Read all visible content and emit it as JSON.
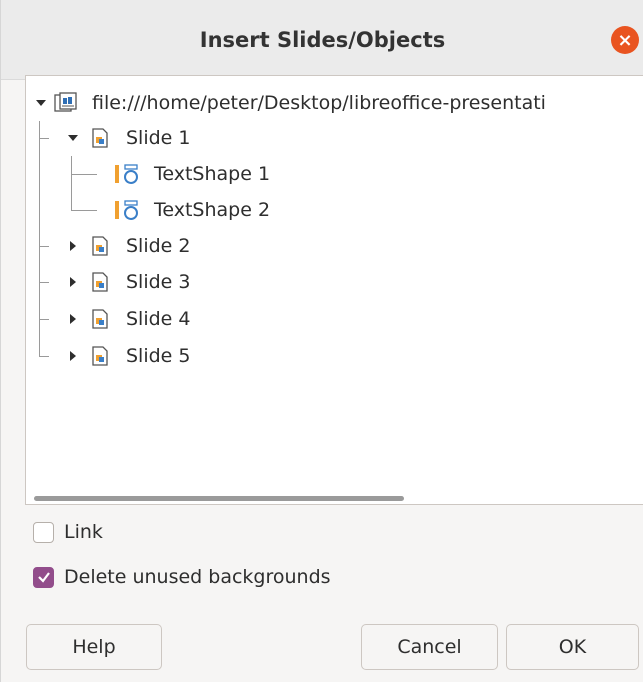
{
  "dialog": {
    "title": "Insert Slides/Objects",
    "close_symbol": "×"
  },
  "tree": {
    "root_label": "file:///home/peter/Desktop/libreoffice-presentati",
    "slides": [
      {
        "label": "Slide 1",
        "expanded": true,
        "children": [
          "TextShape 1",
          "TextShape 2"
        ]
      },
      {
        "label": "Slide 2",
        "expanded": false
      },
      {
        "label": "Slide 3",
        "expanded": false
      },
      {
        "label": "Slide 4",
        "expanded": false
      },
      {
        "label": "Slide 5",
        "expanded": false
      }
    ]
  },
  "options": {
    "link_label": "Link",
    "link_checked": false,
    "delete_backgrounds_label": "Delete unused backgrounds",
    "delete_backgrounds_checked": true
  },
  "buttons": {
    "help": "Help",
    "cancel": "Cancel",
    "ok": "OK"
  },
  "colors": {
    "accent": "#924d8b",
    "close": "#e95420"
  },
  "icons": {
    "document": "document-icon",
    "slide": "slide-icon",
    "textshape": "textshape-icon"
  }
}
